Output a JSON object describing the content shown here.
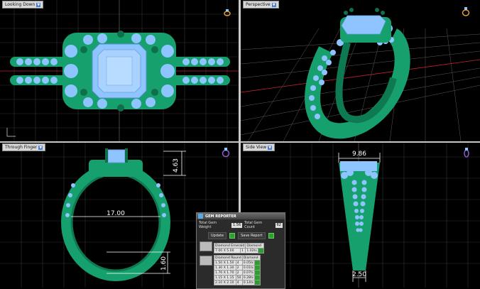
{
  "viewports": {
    "top_left": {
      "label": "Looking Down"
    },
    "top_right": {
      "label": "Perspective"
    },
    "bottom_left": {
      "label": "Through Finger",
      "dims": {
        "top_height": "4.63",
        "inner_width": "17.00",
        "bottom_thickness": "1.60"
      }
    },
    "bottom_right": {
      "label": "Side View",
      "dims": {
        "top_width": "9.86",
        "bottom_width": "2.50"
      }
    }
  },
  "gem_reporter": {
    "title": "GEM REPORTER",
    "weight_label": "Total Gem Weight",
    "weight_value": "1.56",
    "count_label": "Total Gem Count",
    "count_value": "62",
    "update_label": "Update",
    "save_label": "Save Report",
    "emerald_group": {
      "header": [
        "Diamond Emerald",
        "Diamond"
      ],
      "rows": [
        [
          "7.00 X 5.00",
          "1",
          "1.02ts"
        ]
      ]
    },
    "round_group": {
      "header": [
        "Diamond Round",
        "Diamond"
      ],
      "rows": [
        [
          "1.50 X 1.50",
          "4",
          "0.05ts"
        ],
        [
          "1.30 X 1.30",
          "2",
          "0.01ts"
        ],
        [
          "1.70 X 1.70",
          "2",
          "0.07ts"
        ],
        [
          "1.15 X 1.15",
          "50",
          "0.28ts"
        ],
        [
          "2.10 X 2.10",
          "4",
          "0.14ts"
        ]
      ]
    }
  },
  "colors": {
    "metal": "#16a06e",
    "gem": "#8ec4ff",
    "grid": "#3a3a3a",
    "axis_red": "#c0202a"
  }
}
